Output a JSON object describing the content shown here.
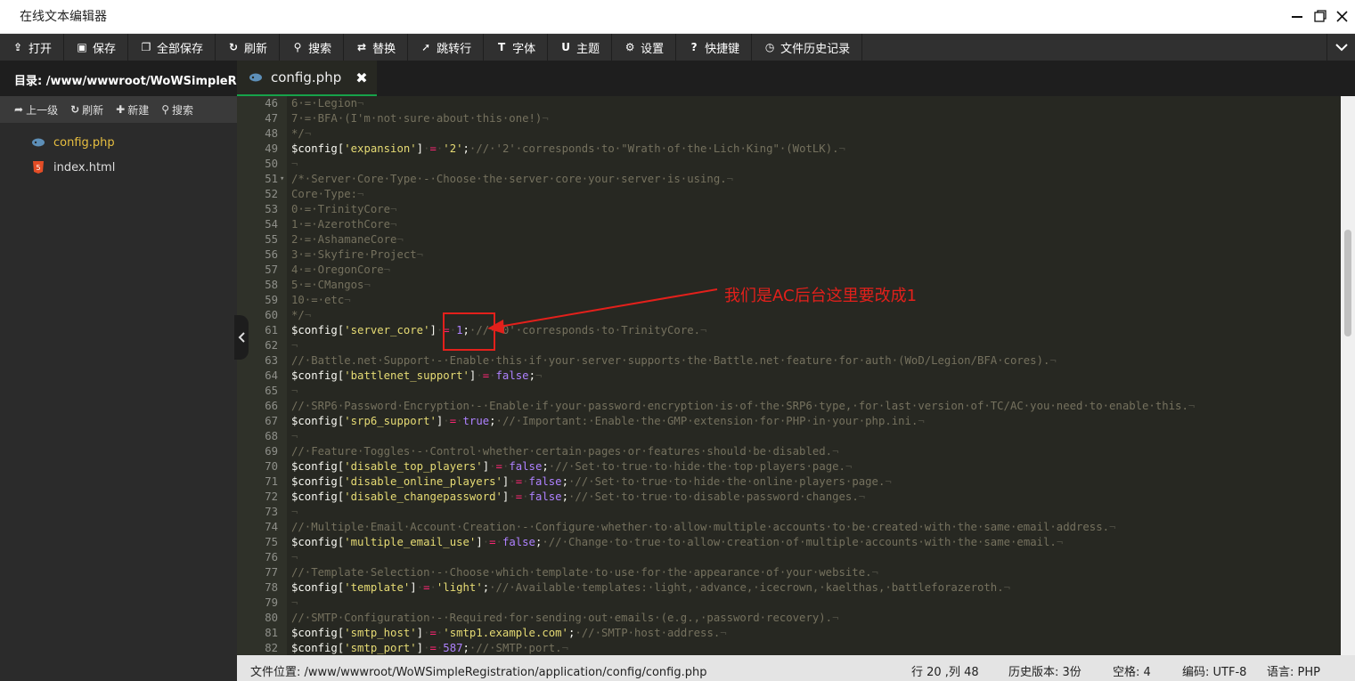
{
  "window": {
    "title": "在线文本编辑器"
  },
  "toolbar": {
    "items": [
      {
        "label": "打开",
        "icon": "upload-icon"
      },
      {
        "label": "保存",
        "icon": "save-icon"
      },
      {
        "label": "全部保存",
        "icon": "save-all-icon"
      },
      {
        "label": "刷新",
        "icon": "refresh-icon"
      },
      {
        "label": "搜索",
        "icon": "search-icon"
      },
      {
        "label": "替换",
        "icon": "replace-icon"
      },
      {
        "label": "跳转行",
        "icon": "goto-line-icon"
      },
      {
        "label": "字体",
        "icon": "font-icon"
      },
      {
        "label": "主题",
        "icon": "theme-icon"
      },
      {
        "label": "设置",
        "icon": "gear-icon"
      },
      {
        "label": "快捷键",
        "icon": "help-icon"
      },
      {
        "label": "文件历史记录",
        "icon": "history-icon"
      }
    ]
  },
  "sidebar": {
    "dir_label": "目录:",
    "dir_path": "/www/wwwroot/WoWSimpleRegi",
    "actions": [
      {
        "label": "上一级",
        "icon": "arrow-up-icon"
      },
      {
        "label": "刷新",
        "icon": "refresh-icon"
      },
      {
        "label": "新建",
        "icon": "plus-icon"
      },
      {
        "label": "搜索",
        "icon": "search-icon"
      }
    ],
    "files": [
      {
        "name": "config.php",
        "icon": "php-file-icon",
        "active": true
      },
      {
        "name": "index.html",
        "icon": "html5-file-icon",
        "active": false
      }
    ]
  },
  "tab": {
    "label": "config.php",
    "close": "✖"
  },
  "editor": {
    "lines": [
      {
        "n": "46",
        "parts": [
          [
            "cm",
            "6·=·Legion"
          ],
          [
            "inv",
            "¬"
          ]
        ]
      },
      {
        "n": "47",
        "parts": [
          [
            "cm",
            "7·=·BFA·(I'm·not·sure·about·this·one!)"
          ],
          [
            "inv",
            "¬"
          ]
        ]
      },
      {
        "n": "48",
        "parts": [
          [
            "cm",
            "*/"
          ],
          [
            "inv",
            "¬"
          ]
        ]
      },
      {
        "n": "49",
        "parts": [
          [
            "var",
            "$config["
          ],
          [
            "str",
            "'expansion'"
          ],
          [
            "var",
            "]"
          ],
          [
            "inv",
            "·"
          ],
          [
            "op",
            "="
          ],
          [
            "inv",
            "·"
          ],
          [
            "str",
            "'2'"
          ],
          [
            "pl",
            ";"
          ],
          [
            "cm",
            "·//·'2'·corresponds·to·\"Wrath·of·the·Lich·King\"·(WotLK)."
          ],
          [
            "inv",
            "¬"
          ]
        ]
      },
      {
        "n": "50",
        "parts": [
          [
            "inv",
            "¬"
          ]
        ]
      },
      {
        "n": "51",
        "fold": true,
        "parts": [
          [
            "cm",
            "/*·Server·Core·Type·-·Choose·the·server·core·your·server·is·using."
          ],
          [
            "inv",
            "¬"
          ]
        ]
      },
      {
        "n": "52",
        "parts": [
          [
            "cm",
            "Core·Type:"
          ],
          [
            "inv",
            "¬"
          ]
        ]
      },
      {
        "n": "53",
        "parts": [
          [
            "cm",
            "0·=·TrinityCore"
          ],
          [
            "inv",
            "¬"
          ]
        ]
      },
      {
        "n": "54",
        "parts": [
          [
            "cm",
            "1·=·AzerothCore"
          ],
          [
            "inv",
            "¬"
          ]
        ]
      },
      {
        "n": "55",
        "parts": [
          [
            "cm",
            "2·=·AshamaneCore"
          ],
          [
            "inv",
            "¬"
          ]
        ]
      },
      {
        "n": "56",
        "parts": [
          [
            "cm",
            "3·=·Skyfire·Project"
          ],
          [
            "inv",
            "¬"
          ]
        ]
      },
      {
        "n": "57",
        "parts": [
          [
            "cm",
            "4·=·OregonCore"
          ],
          [
            "inv",
            "¬"
          ]
        ]
      },
      {
        "n": "58",
        "parts": [
          [
            "cm",
            "5·=·CMangos"
          ],
          [
            "inv",
            "¬"
          ]
        ]
      },
      {
        "n": "59",
        "parts": [
          [
            "cm",
            "10·=·etc"
          ],
          [
            "inv",
            "¬"
          ]
        ]
      },
      {
        "n": "60",
        "parts": [
          [
            "cm",
            "*/"
          ],
          [
            "inv",
            "¬"
          ]
        ]
      },
      {
        "n": "61",
        "parts": [
          [
            "var",
            "$config["
          ],
          [
            "str",
            "'server_core'"
          ],
          [
            "var",
            "]"
          ],
          [
            "inv",
            "·"
          ],
          [
            "op",
            "="
          ],
          [
            "inv",
            "·"
          ],
          [
            "num",
            "1"
          ],
          [
            "pl",
            ";"
          ],
          [
            "cm",
            "·//·'0'·corresponds·to·TrinityCore."
          ],
          [
            "inv",
            "¬"
          ]
        ]
      },
      {
        "n": "62",
        "parts": [
          [
            "inv",
            "¬"
          ]
        ]
      },
      {
        "n": "63",
        "parts": [
          [
            "cm",
            "//·Battle.net·Support·-·Enable·this·if·your·server·supports·the·Battle.net·feature·for·auth·(WoD/Legion/BFA·cores)."
          ],
          [
            "inv",
            "¬"
          ]
        ]
      },
      {
        "n": "64",
        "parts": [
          [
            "var",
            "$config["
          ],
          [
            "str",
            "'battlenet_support'"
          ],
          [
            "var",
            "]"
          ],
          [
            "inv",
            "·"
          ],
          [
            "op",
            "="
          ],
          [
            "inv",
            "·"
          ],
          [
            "kw",
            "false"
          ],
          [
            "pl",
            ";"
          ],
          [
            "inv",
            "¬"
          ]
        ]
      },
      {
        "n": "65",
        "parts": [
          [
            "inv",
            "¬"
          ]
        ]
      },
      {
        "n": "66",
        "parts": [
          [
            "cm",
            "//·SRP6·Password·Encryption·-·Enable·if·your·password·encryption·is·of·the·SRP6·type,·for·last·version·of·TC/AC·you·need·to·enable·this."
          ],
          [
            "inv",
            "¬"
          ]
        ]
      },
      {
        "n": "67",
        "parts": [
          [
            "var",
            "$config["
          ],
          [
            "str",
            "'srp6_support'"
          ],
          [
            "var",
            "]"
          ],
          [
            "inv",
            "·"
          ],
          [
            "op",
            "="
          ],
          [
            "inv",
            "·"
          ],
          [
            "kw",
            "true"
          ],
          [
            "pl",
            ";"
          ],
          [
            "cm",
            "·//·Important:·Enable·the·GMP·extension·for·PHP·in·your·php.ini."
          ],
          [
            "inv",
            "¬"
          ]
        ]
      },
      {
        "n": "68",
        "parts": [
          [
            "inv",
            "¬"
          ]
        ]
      },
      {
        "n": "69",
        "parts": [
          [
            "cm",
            "//·Feature·Toggles·-·Control·whether·certain·pages·or·features·should·be·disabled."
          ],
          [
            "inv",
            "¬"
          ]
        ]
      },
      {
        "n": "70",
        "parts": [
          [
            "var",
            "$config["
          ],
          [
            "str",
            "'disable_top_players'"
          ],
          [
            "var",
            "]"
          ],
          [
            "inv",
            "·"
          ],
          [
            "op",
            "="
          ],
          [
            "inv",
            "·"
          ],
          [
            "kw",
            "false"
          ],
          [
            "pl",
            ";"
          ],
          [
            "cm",
            "·//·Set·to·true·to·hide·the·top·players·page."
          ],
          [
            "inv",
            "¬"
          ]
        ]
      },
      {
        "n": "71",
        "parts": [
          [
            "var",
            "$config["
          ],
          [
            "str",
            "'disable_online_players'"
          ],
          [
            "var",
            "]"
          ],
          [
            "inv",
            "·"
          ],
          [
            "op",
            "="
          ],
          [
            "inv",
            "·"
          ],
          [
            "kw",
            "false"
          ],
          [
            "pl",
            ";"
          ],
          [
            "cm",
            "·//·Set·to·true·to·hide·the·online·players·page."
          ],
          [
            "inv",
            "¬"
          ]
        ]
      },
      {
        "n": "72",
        "parts": [
          [
            "var",
            "$config["
          ],
          [
            "str",
            "'disable_changepassword'"
          ],
          [
            "var",
            "]"
          ],
          [
            "inv",
            "·"
          ],
          [
            "op",
            "="
          ],
          [
            "inv",
            "·"
          ],
          [
            "kw",
            "false"
          ],
          [
            "pl",
            ";"
          ],
          [
            "cm",
            "·//·Set·to·true·to·disable·password·changes."
          ],
          [
            "inv",
            "¬"
          ]
        ]
      },
      {
        "n": "73",
        "parts": [
          [
            "inv",
            "¬"
          ]
        ]
      },
      {
        "n": "74",
        "parts": [
          [
            "cm",
            "//·Multiple·Email·Account·Creation·-·Configure·whether·to·allow·multiple·accounts·to·be·created·with·the·same·email·address."
          ],
          [
            "inv",
            "¬"
          ]
        ]
      },
      {
        "n": "75",
        "parts": [
          [
            "var",
            "$config["
          ],
          [
            "str",
            "'multiple_email_use'"
          ],
          [
            "var",
            "]"
          ],
          [
            "inv",
            "·"
          ],
          [
            "op",
            "="
          ],
          [
            "inv",
            "·"
          ],
          [
            "kw",
            "false"
          ],
          [
            "pl",
            ";"
          ],
          [
            "cm",
            "·//·Change·to·true·to·allow·creation·of·multiple·accounts·with·the·same·email."
          ],
          [
            "inv",
            "¬"
          ]
        ]
      },
      {
        "n": "76",
        "parts": [
          [
            "inv",
            "¬"
          ]
        ]
      },
      {
        "n": "77",
        "parts": [
          [
            "cm",
            "//·Template·Selection·-·Choose·which·template·to·use·for·the·appearance·of·your·website."
          ],
          [
            "inv",
            "¬"
          ]
        ]
      },
      {
        "n": "78",
        "parts": [
          [
            "var",
            "$config["
          ],
          [
            "str",
            "'template'"
          ],
          [
            "var",
            "]"
          ],
          [
            "inv",
            "·"
          ],
          [
            "op",
            "="
          ],
          [
            "inv",
            "·"
          ],
          [
            "str",
            "'light'"
          ],
          [
            "pl",
            ";"
          ],
          [
            "cm",
            "·//·Available·templates:·light,·advance,·icecrown,·kaelthas,·battleforazeroth."
          ],
          [
            "inv",
            "¬"
          ]
        ]
      },
      {
        "n": "79",
        "parts": [
          [
            "inv",
            "¬"
          ]
        ]
      },
      {
        "n": "80",
        "parts": [
          [
            "cm",
            "//·SMTP·Configuration·-·Required·for·sending·out·emails·(e.g.,·password·recovery)."
          ],
          [
            "inv",
            "¬"
          ]
        ]
      },
      {
        "n": "81",
        "parts": [
          [
            "var",
            "$config["
          ],
          [
            "str",
            "'smtp_host'"
          ],
          [
            "var",
            "]"
          ],
          [
            "inv",
            "·"
          ],
          [
            "op",
            "="
          ],
          [
            "inv",
            "·"
          ],
          [
            "str",
            "'smtp1.example.com'"
          ],
          [
            "pl",
            ";"
          ],
          [
            "cm",
            "·//·SMTP·host·address."
          ],
          [
            "inv",
            "¬"
          ]
        ]
      },
      {
        "n": "82",
        "parts": [
          [
            "var",
            "$config["
          ],
          [
            "str",
            "'smtp_port'"
          ],
          [
            "var",
            "]"
          ],
          [
            "inv",
            "·"
          ],
          [
            "op",
            "="
          ],
          [
            "inv",
            "·"
          ],
          [
            "num",
            "587"
          ],
          [
            "pl",
            ";"
          ],
          [
            "cm",
            "·//·SMTP·port."
          ],
          [
            "inv",
            "¬"
          ]
        ]
      }
    ]
  },
  "annotation": {
    "text": "我们是AC后台这里要改成1",
    "color": "#e3201b"
  },
  "status": {
    "path": "文件位置: /www/wwwroot/WoWSimpleRegistration/application/config/config.php",
    "cursor": "行 20 ,列 48",
    "history": "历史版本: 3份",
    "indent": "空格: 4",
    "encoding": "编码: UTF-8",
    "language": "语言: PHP"
  }
}
